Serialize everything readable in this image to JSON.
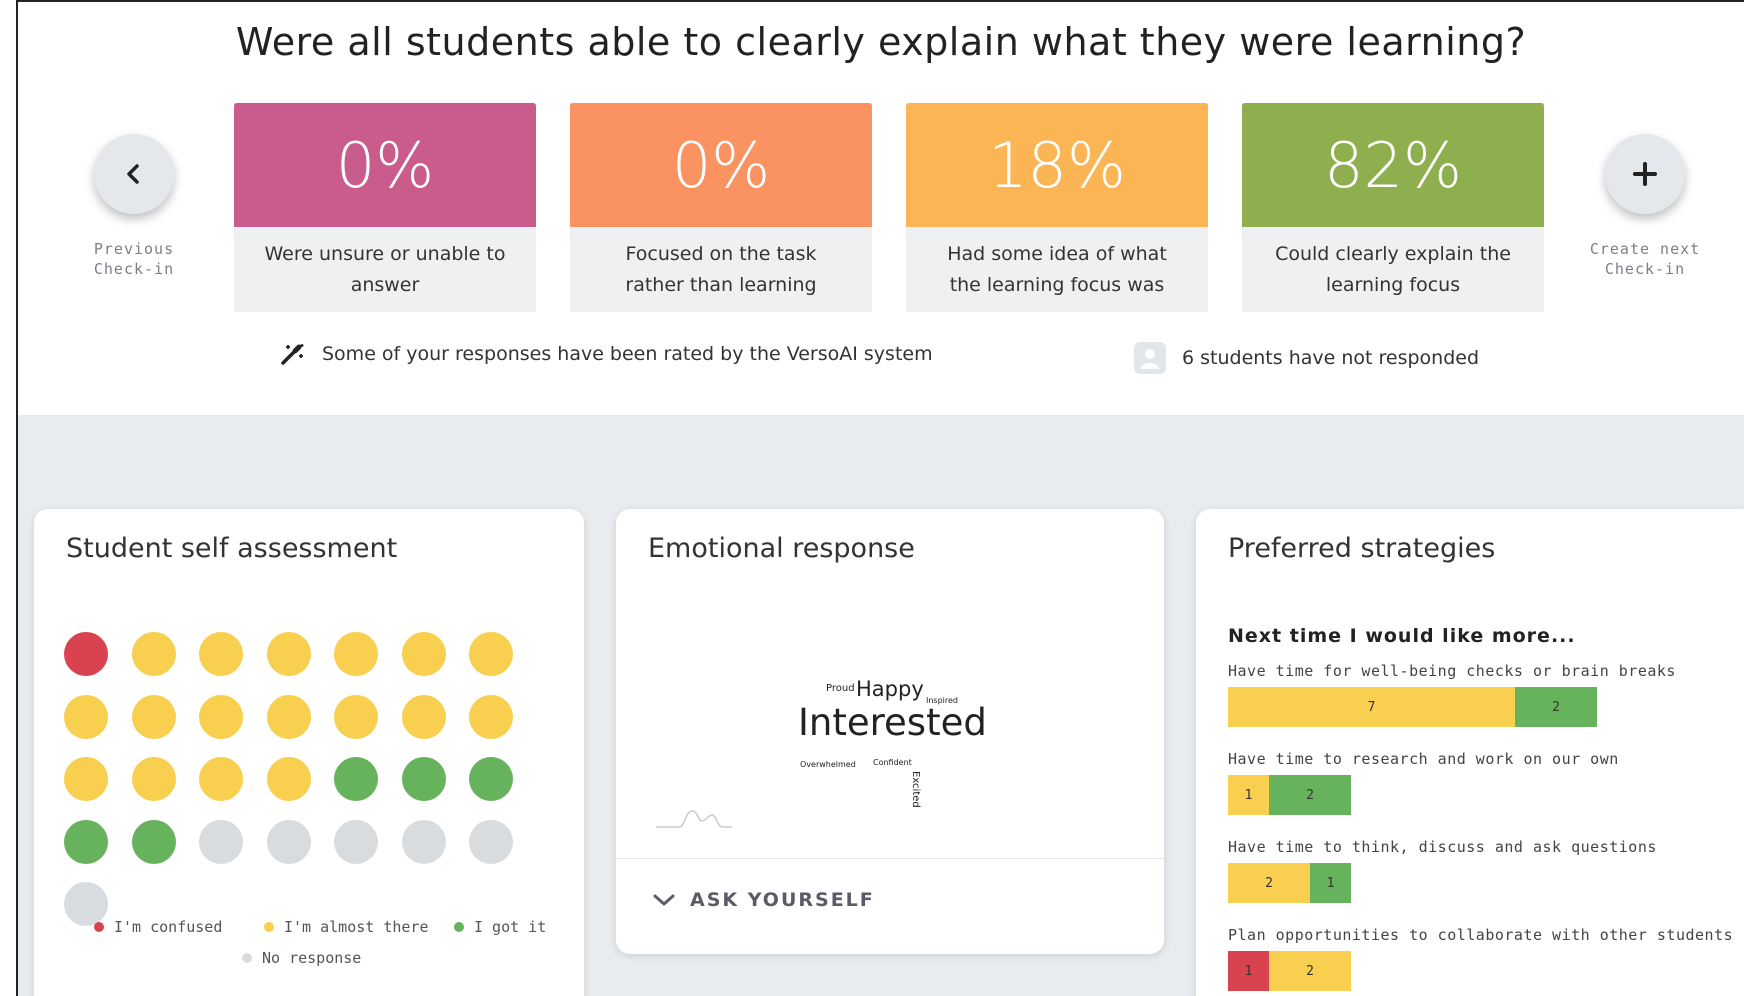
{
  "question": "Were all students able to clearly explain what they were learning?",
  "nav": {
    "previous_label": "Previous Check-in",
    "next_label": "Create next Check-in"
  },
  "stats": [
    {
      "value": "0%",
      "label": "Were unsure or unable to answer",
      "color": "#c95c8c"
    },
    {
      "value": "0%",
      "label": "Focused on the task rather than learning",
      "color": "#fb9262"
    },
    {
      "value": "18%",
      "label": "Had some idea of what the learning focus was",
      "color": "#fbb555"
    },
    {
      "value": "82%",
      "label": "Could clearly explain the learning focus",
      "color": "#8fae4d"
    }
  ],
  "info": {
    "ai_notice": "Some of your responses have been rated by the VersoAI system",
    "not_responded": "6 students have not responded"
  },
  "self_assessment": {
    "title": "Student self assessment",
    "counts": {
      "confused": 1,
      "almost": 17,
      "got_it": 5,
      "no_response": 6
    },
    "legend": {
      "confused": "I'm confused",
      "almost": "I'm almost there",
      "got_it": "I got it",
      "no_response": "No response"
    },
    "colors": {
      "confused": "#d9434f",
      "almost": "#f8cf4e",
      "got_it": "#66b25d",
      "no_response": "#d8dcdf"
    }
  },
  "emotional": {
    "title": "Emotional response",
    "words": {
      "interested": "Interested",
      "happy": "Happy",
      "proud": "Proud",
      "inspired": "Inspired",
      "overwhelmed": "Overwhelmed",
      "confident": "Confident",
      "excited": "Excited"
    },
    "ask_label": "ASK YOURSELF"
  },
  "strategies": {
    "title": "Preferred strategies",
    "heading": "Next time I would like more...",
    "items": [
      {
        "label": "Have time for well-being checks or brain breaks",
        "segments": [
          {
            "value": 7,
            "color": "#f8cf4e"
          },
          {
            "value": 2,
            "color": "#66b25d"
          }
        ]
      },
      {
        "label": "Have time to research and work on our own",
        "segments": [
          {
            "value": 1,
            "color": "#f8cf4e"
          },
          {
            "value": 2,
            "color": "#66b25d"
          }
        ]
      },
      {
        "label": "Have time to think, discuss and ask questions",
        "segments": [
          {
            "value": 2,
            "color": "#f8cf4e"
          },
          {
            "value": 1,
            "color": "#66b25d"
          }
        ]
      },
      {
        "label": "Plan opportunities to collaborate with other students",
        "segments": [
          {
            "value": 1,
            "color": "#d9434f"
          },
          {
            "value": 2,
            "color": "#f8cf4e"
          }
        ]
      }
    ]
  }
}
